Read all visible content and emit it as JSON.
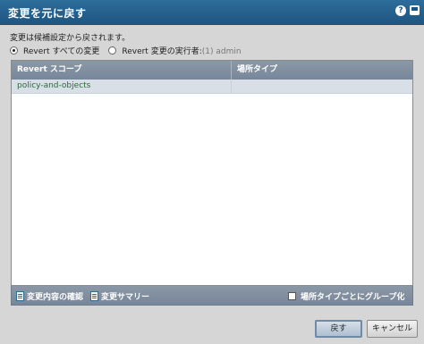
{
  "dialog": {
    "title": "変更を元に戻す",
    "info_text": "変更は候補設定から戻されます。"
  },
  "options": {
    "revert_all_label": "Revert すべての変更",
    "revert_by_label": "Revert 変更の実行者:",
    "revert_by_value": "(1) admin",
    "selected": "revert_all"
  },
  "table": {
    "columns": [
      "Revert スコープ",
      "場所タイプ"
    ],
    "rows": [
      {
        "scope": "policy-and-objects",
        "location_type": ""
      }
    ]
  },
  "footer": {
    "details_label": "変更内容の確認",
    "summary_label": "変更サマリー",
    "group_label": "場所タイプごとにグループ化",
    "group_checked": false
  },
  "buttons": {
    "revert": "戻す",
    "cancel": "キャンセル"
  },
  "icons": {
    "help": "help-icon",
    "window": "window-icon",
    "details": "document-icon",
    "summary": "document-icon"
  }
}
